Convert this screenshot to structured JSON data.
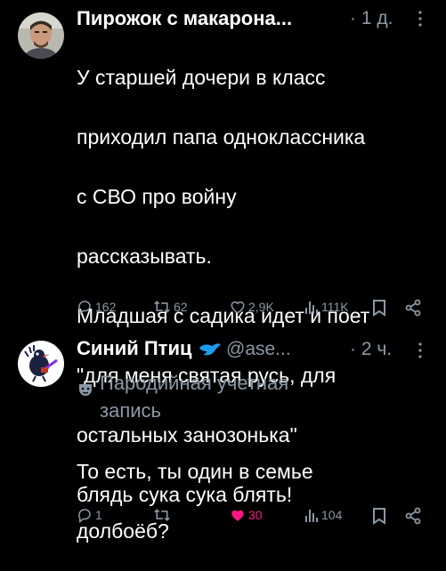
{
  "tweet1": {
    "author_name": "Пирожок с макарона...",
    "time": "1 д.",
    "text_lines": [
      "У старшей дочери в класс",
      "приходил папа одноклассника",
      "с СВО про войну",
      "рассказывать.",
      "Младшая с садика идет и поет",
      "\"для меня святая русь, для",
      "остальных занозонька\"",
      "блядь сука сука блять!"
    ],
    "replies": "162",
    "reposts": "62",
    "likes": "2,9K",
    "views": "111K"
  },
  "tweet2": {
    "author_name": "Синий Птиц",
    "handle": "@ase...",
    "time": "2 ч.",
    "parody_label_lines": [
      "Пародийная учетная",
      "запись"
    ],
    "text_lines": [
      "То есть, ты один в семье",
      "долбоёб?"
    ],
    "replies": "1",
    "reposts": "",
    "likes": "30",
    "views": "104"
  },
  "icons": {
    "reply": "reply-icon",
    "repost": "repost-icon",
    "like": "like-icon",
    "views": "views-icon",
    "bookmark": "bookmark-icon",
    "share": "share-icon",
    "more": "more-icon",
    "verified_bird": "bird-badge-icon",
    "parody_mask": "theater-mask-icon"
  },
  "colors": {
    "background": "#000000",
    "text": "#ffffff",
    "muted": "#8b98a5",
    "like_active": "#f91880",
    "bird_badge": "#1d9bf0"
  }
}
